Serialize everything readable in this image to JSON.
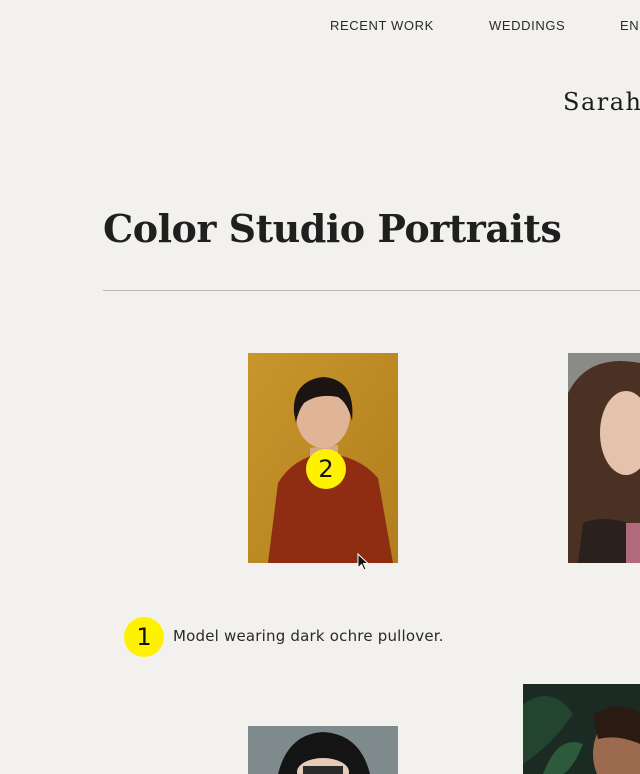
{
  "nav": {
    "items": [
      {
        "label": "RECENT WORK"
      },
      {
        "label": "WEDDINGS"
      },
      {
        "label": "EN"
      }
    ]
  },
  "brand": {
    "name": "Sarah"
  },
  "page": {
    "title": "Color Studio Portraits"
  },
  "gallery": {
    "items": [
      {
        "alt": "Model wearing dark ochre pullover",
        "badge": "2"
      },
      {
        "alt": "Portrait of woman with long brown hair"
      },
      {
        "alt": "Portrait of person in black hat"
      },
      {
        "alt": "Portrait with green leaves"
      }
    ],
    "caption": {
      "badge": "1",
      "text": "Model wearing dark ochre pullover."
    }
  },
  "colors": {
    "background": "#f2f1ee",
    "badge": "#fff200",
    "text": "#1c1c1c"
  }
}
